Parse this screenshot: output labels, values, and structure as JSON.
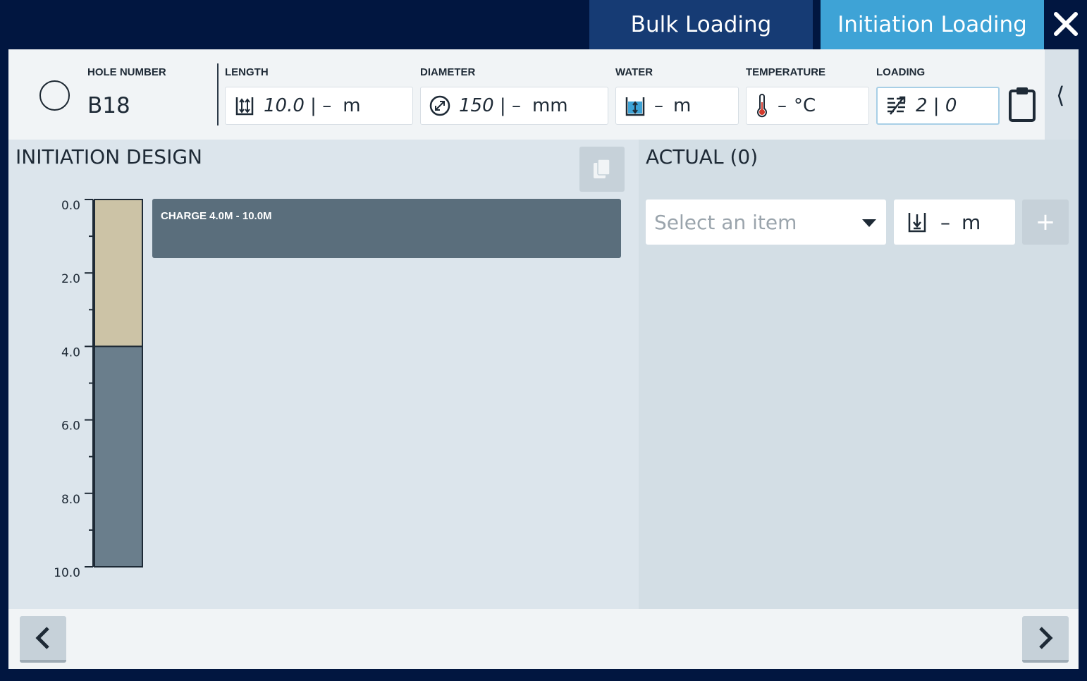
{
  "tabs": {
    "bulk_label": "Bulk Loading",
    "initiation_label": "Initiation Loading",
    "active": "Initiation Loading"
  },
  "header": {
    "hole_number_label": "HOLE NUMBER",
    "hole_number_value": "B18",
    "length_label": "LENGTH",
    "length_design": "10.0",
    "length_sep": " | ",
    "length_actual": "–",
    "length_unit": "m",
    "diameter_label": "DIAMETER",
    "diameter_design": "150",
    "diameter_sep": " | ",
    "diameter_actual": "–",
    "diameter_unit": "mm",
    "water_label": "WATER",
    "water_value": "–",
    "water_unit": "m",
    "temperature_label": "TEMPERATURE",
    "temperature_value": "–",
    "temperature_unit": "°C",
    "loading_label": "LOADING",
    "loading_value": "2 | 0"
  },
  "design": {
    "title": "INITIATION DESIGN",
    "charge_label": "CHARGE 4.0M - 10.0M",
    "depth_scale": {
      "min": 0,
      "max": 10,
      "tick_labels": [
        "0.0",
        "2.0",
        "4.0",
        "6.0",
        "8.0",
        "10.0"
      ],
      "segments": [
        {
          "from": 0.0,
          "to": 4.0,
          "kind": "stemming",
          "color": "#ccc3a6"
        },
        {
          "from": 4.0,
          "to": 10.0,
          "kind": "charge",
          "color": "#6a7e8c"
        }
      ]
    }
  },
  "actual": {
    "title": "ACTUAL (0)",
    "select_placeholder": "Select an item",
    "length_value": "–",
    "length_unit": "m",
    "add_label": "+"
  },
  "colors": {
    "background": "#011640",
    "tab_bulk": "#163b74",
    "tab_initiation": "#3ea3d6",
    "charge_bar": "#5a6e7c"
  },
  "icons": {
    "close": "close-icon",
    "length": "length-icon",
    "diameter": "diameter-icon",
    "water": "water-icon",
    "temperature": "thermometer-icon",
    "loading": "loading-icon",
    "clipboard": "clipboard-icon",
    "copy": "copy-icon",
    "prev": "chevron-left-icon",
    "next": "chevron-right-icon"
  }
}
